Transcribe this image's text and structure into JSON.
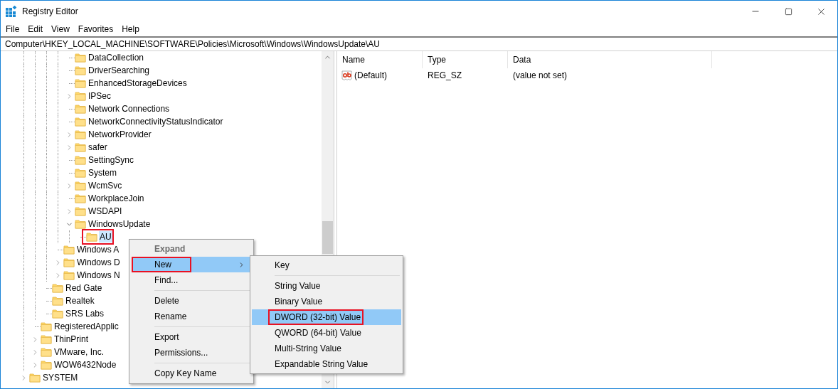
{
  "window": {
    "title": "Registry Editor"
  },
  "menu_bar": [
    "File",
    "Edit",
    "View",
    "Favorites",
    "Help"
  ],
  "address": "Computer\\HKEY_LOCAL_MACHINE\\SOFTWARE\\Policies\\Microsoft\\Windows\\WindowsUpdate\\AU",
  "tree": {
    "items": [
      {
        "children": [
          {
            "children": [
              {
                "children": [
                  {
                    "children": [
                      {
                        "label": "DataCollection",
                        "selected": false,
                        "marked": false
                      },
                      {
                        "label": "DriverSearching",
                        "selected": false,
                        "marked": false
                      },
                      {
                        "label": "EnhancedStorageDevices",
                        "selected": false,
                        "marked": false
                      },
                      {
                        "label": "IPSec",
                        "expanded": false,
                        "selected": false,
                        "marked": false
                      },
                      {
                        "label": "Network Connections",
                        "selected": false,
                        "marked": false
                      },
                      {
                        "label": "NetworkConnectivityStatusIndicator",
                        "selected": false,
                        "marked": false
                      },
                      {
                        "label": "NetworkProvider",
                        "expanded": false,
                        "selected": false,
                        "marked": false
                      },
                      {
                        "label": "safer",
                        "expanded": false,
                        "selected": false,
                        "marked": false
                      },
                      {
                        "label": "SettingSync",
                        "selected": false,
                        "marked": false
                      },
                      {
                        "label": "System",
                        "selected": false,
                        "marked": false
                      },
                      {
                        "label": "WcmSvc",
                        "expanded": false,
                        "selected": false,
                        "marked": false
                      },
                      {
                        "label": "WorkplaceJoin",
                        "selected": false,
                        "marked": false
                      },
                      {
                        "label": "WSDAPI",
                        "expanded": false,
                        "selected": false,
                        "marked": false
                      },
                      {
                        "label": "WindowsUpdate",
                        "expanded": true,
                        "selected": false,
                        "marked": false,
                        "children": [
                          {
                            "label": "AU",
                            "selected": true,
                            "marked": true
                          }
                        ]
                      }
                    ]
                  },
                  {
                    "label": "Windows A",
                    "selected": false,
                    "marked": false
                  },
                  {
                    "label": "Windows D",
                    "expanded": false,
                    "selected": false,
                    "marked": false
                  },
                  {
                    "label": "Windows N",
                    "expanded": false,
                    "selected": false,
                    "marked": false
                  }
                ]
              },
              {
                "label": "Red Gate",
                "selected": false,
                "marked": false
              },
              {
                "label": "Realtek",
                "selected": false,
                "marked": false
              },
              {
                "label": "SRS Labs",
                "selected": false,
                "marked": false
              }
            ]
          },
          {
            "label": "RegisteredApplic",
            "selected": false,
            "marked": false
          },
          {
            "label": "ThinPrint",
            "expanded": false,
            "selected": false,
            "marked": false
          },
          {
            "label": "VMware, Inc.",
            "expanded": false,
            "selected": false,
            "marked": false
          },
          {
            "label": "WOW6432Node",
            "expanded": false,
            "selected": false,
            "marked": false
          }
        ]
      },
      {
        "label": "SYSTEM",
        "expanded": false,
        "selected": false,
        "marked": false
      }
    ]
  },
  "values": {
    "columns": [
      "Name",
      "Type",
      "Data"
    ],
    "rows": [
      {
        "name": "(Default)",
        "type": "REG_SZ",
        "data": "(value not set)"
      }
    ]
  },
  "context_menu": {
    "items": [
      {
        "kind": "item",
        "label": "Expand",
        "disabled": true,
        "default": true,
        "highlighted": false,
        "marked": false
      },
      {
        "kind": "submenu",
        "label": "New",
        "disabled": false,
        "default": false,
        "highlighted": true,
        "marked": true
      },
      {
        "kind": "item",
        "label": "Find...",
        "disabled": false,
        "default": false,
        "highlighted": false,
        "marked": false
      },
      {
        "kind": "separator"
      },
      {
        "kind": "item",
        "label": "Delete",
        "disabled": false,
        "default": false,
        "highlighted": false,
        "marked": false
      },
      {
        "kind": "item",
        "label": "Rename",
        "disabled": false,
        "default": false,
        "highlighted": false,
        "marked": false
      },
      {
        "kind": "separator"
      },
      {
        "kind": "item",
        "label": "Export",
        "disabled": false,
        "default": false,
        "highlighted": false,
        "marked": false
      },
      {
        "kind": "item",
        "label": "Permissions...",
        "disabled": false,
        "default": false,
        "highlighted": false,
        "marked": false
      },
      {
        "kind": "separator"
      },
      {
        "kind": "item",
        "label": "Copy Key Name",
        "disabled": false,
        "default": false,
        "highlighted": false,
        "marked": false
      }
    ]
  },
  "submenu": {
    "items": [
      {
        "kind": "item",
        "label": "Key",
        "highlighted": false,
        "marked": false
      },
      {
        "kind": "separator"
      },
      {
        "kind": "item",
        "label": "String Value",
        "highlighted": false,
        "marked": false
      },
      {
        "kind": "item",
        "label": "Binary Value",
        "highlighted": false,
        "marked": false
      },
      {
        "kind": "item",
        "label": "DWORD (32-bit) Value",
        "highlighted": true,
        "marked": true
      },
      {
        "kind": "item",
        "label": "QWORD (64-bit) Value",
        "highlighted": false,
        "marked": false
      },
      {
        "kind": "item",
        "label": "Multi-String Value",
        "highlighted": false,
        "marked": false
      },
      {
        "kind": "item",
        "label": "Expandable String Value",
        "highlighted": false,
        "marked": false
      }
    ]
  }
}
